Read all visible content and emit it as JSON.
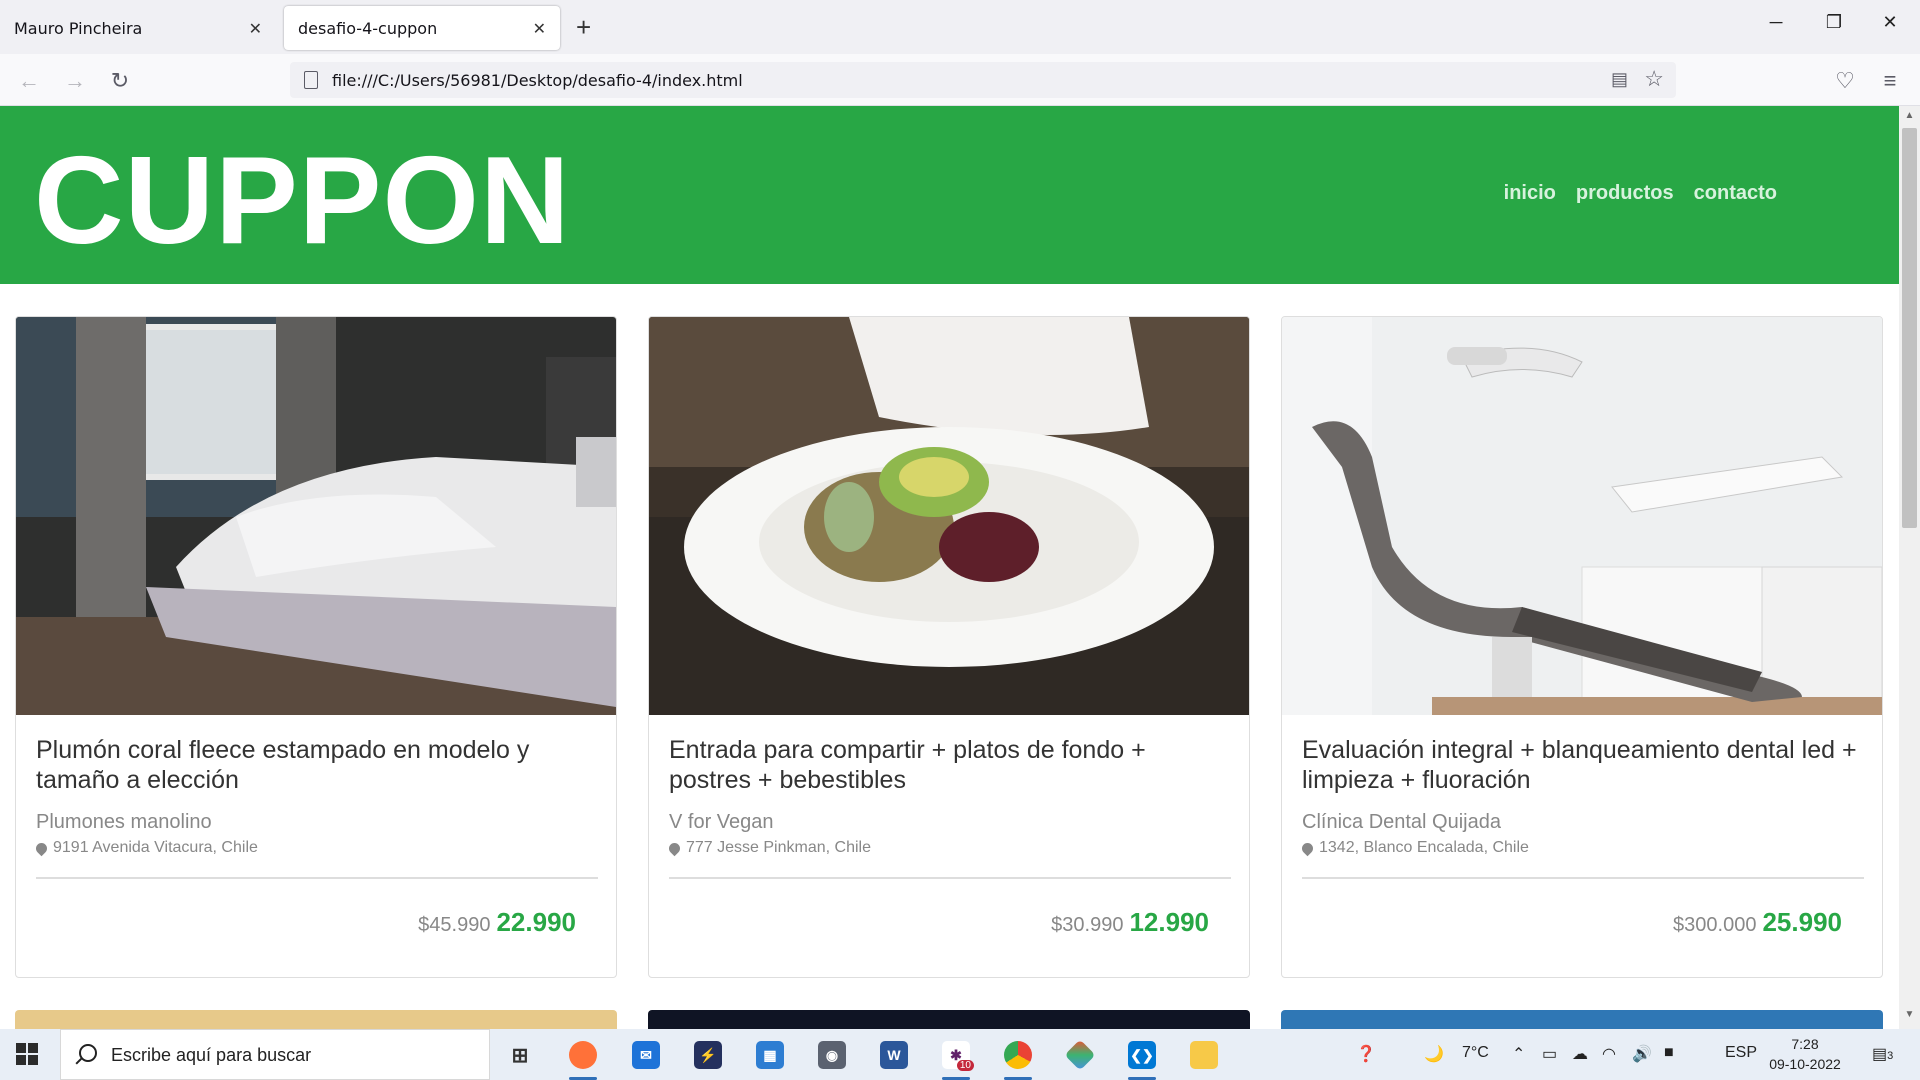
{
  "browser": {
    "tabs": [
      {
        "label": "Mauro Pincheira",
        "active": false
      },
      {
        "label": "desafio-4-cuppon",
        "active": true
      }
    ],
    "url": "file:///C:/Users/56981/Desktop/desafio-4/index.html"
  },
  "site": {
    "logo": "CUPPON",
    "nav": [
      "inicio",
      "productos",
      "contacto"
    ],
    "accent_color": "#28a745"
  },
  "cards": [
    {
      "title": "Plumón coral fleece estampado en modelo y tamaño a elección",
      "vendor": "Plumones manolino",
      "address": "9191 Avenida Vitacura, Chile",
      "old_price": "$45.990",
      "new_price": "22.990"
    },
    {
      "title": "Entrada para compartir + platos de fondo + postres + bebestibles",
      "vendor": "V for Vegan",
      "address": "777 Jesse Pinkman, Chile",
      "old_price": "$30.990",
      "new_price": "12.990"
    },
    {
      "title": "Evaluación integral + blanqueamiento dental led + limpieza + fluoración",
      "vendor": "Clínica Dental Quijada",
      "address": "1342, Blanco Encalada, Chile",
      "old_price": "$300.000",
      "new_price": "25.990"
    }
  ],
  "taskbar": {
    "search_placeholder": "Escribe aquí para buscar",
    "weather": "7°C",
    "language": "ESP",
    "time": "7:28",
    "date": "09-10-2022",
    "notifications": "3",
    "slack_badge": "10"
  }
}
